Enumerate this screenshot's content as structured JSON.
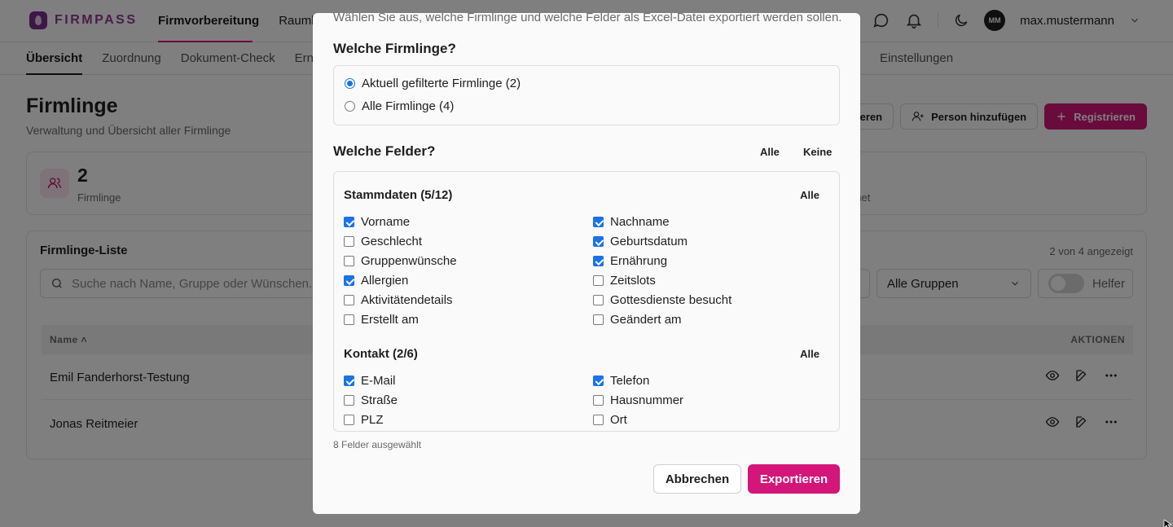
{
  "app": {
    "brand": "FIRMPASS",
    "accent": "#d4167a",
    "brand_color": "#8e3b96"
  },
  "main_nav": [
    "Firmvorbereitung",
    "Raumbu"
  ],
  "user": {
    "initials": "MM",
    "name": "max.mustermann"
  },
  "sub_nav": {
    "left": [
      "Übersicht",
      "Zuordnung",
      "Dokument-Check",
      "Ern"
    ],
    "right": [
      "ing",
      "Einstellungen"
    ]
  },
  "page": {
    "title": "Firmlinge",
    "subtitle": "Verwaltung und Übersicht aller Firmlinge"
  },
  "header_buttons": {
    "export_partial": "rtieren",
    "add_person": "Person hinzufügen",
    "register": "Registrieren"
  },
  "stats": {
    "count": "2",
    "label": "Firmlinge",
    "right_label": "dnet"
  },
  "list": {
    "title": "Firmlinge-Liste",
    "count_text": "2 von 4 angezeigt",
    "search_placeholder": "Suche nach Name, Gruppe oder Wünschen...",
    "group_select": "Alle Gruppen",
    "helper_toggle": "Helfer",
    "col_name": "Name",
    "col_actions": "AKTIONEN",
    "rows": [
      "Emil Fanderhorst-Testung",
      "Jonas Reitmeier"
    ]
  },
  "modal": {
    "description": "Wählen Sie aus, welche Firmlinge und welche Felder als Excel-Datei exportiert werden sollen.",
    "which_firmlinge": "Welche Firmlinge?",
    "radio_options": [
      {
        "label": "Aktuell gefilterte Firmlinge (2)",
        "selected": true
      },
      {
        "label": "Alle Firmlinge (4)",
        "selected": false
      }
    ],
    "which_fields": "Welche Felder?",
    "select_all": "Alle",
    "select_none": "Keine",
    "groups": [
      {
        "title": "Stammdaten (5/12)",
        "all_label": "Alle",
        "fields": [
          {
            "label": "Vorname",
            "checked": true
          },
          {
            "label": "Nachname",
            "checked": true
          },
          {
            "label": "Geschlecht",
            "checked": false
          },
          {
            "label": "Geburtsdatum",
            "checked": true
          },
          {
            "label": "Gruppenwünsche",
            "checked": false
          },
          {
            "label": "Ernährung",
            "checked": true
          },
          {
            "label": "Allergien",
            "checked": true
          },
          {
            "label": "Zeitslots",
            "checked": false
          },
          {
            "label": "Aktivitätendetails",
            "checked": false
          },
          {
            "label": "Gottesdienste besucht",
            "checked": false
          },
          {
            "label": "Erstellt am",
            "checked": false
          },
          {
            "label": "Geändert am",
            "checked": false
          }
        ]
      },
      {
        "title": "Kontakt (2/6)",
        "all_label": "Alle",
        "fields": [
          {
            "label": "E-Mail",
            "checked": true
          },
          {
            "label": "Telefon",
            "checked": true
          },
          {
            "label": "Straße",
            "checked": false
          },
          {
            "label": "Hausnummer",
            "checked": false
          },
          {
            "label": "PLZ",
            "checked": false
          },
          {
            "label": "Ort",
            "checked": false
          }
        ]
      }
    ],
    "selected_count": "8 Felder ausgewählt",
    "cancel": "Abbrechen",
    "export": "Exportieren"
  }
}
